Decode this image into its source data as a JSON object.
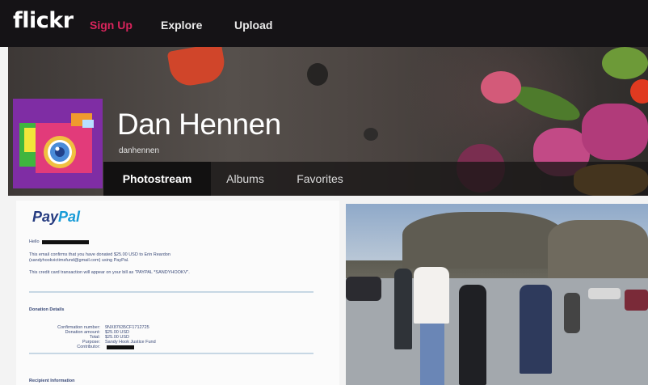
{
  "nav": {
    "logo": "flickr",
    "items": [
      {
        "label": "Sign Up",
        "color": "#d9245c"
      },
      {
        "label": "Explore",
        "color": "#e9e9e9"
      },
      {
        "label": "Upload",
        "color": "#e9e9e9"
      }
    ]
  },
  "profile": {
    "name": "Dan Hennen",
    "handle": "danhennen"
  },
  "tabs": [
    {
      "label": "Photostream",
      "active": true
    },
    {
      "label": "Albums",
      "active": false
    },
    {
      "label": "Favorites",
      "active": false
    }
  ],
  "receipt": {
    "logo_part1": "Pay",
    "logo_part2": "Pal",
    "greeting": "Hello",
    "line1": "This email confirms that you have donated $25.00 USD to Erin Reardon",
    "line2": "(sandyhookvictimsfund@gmail.com) using PayPal.",
    "line3": "This credit card transaction will appear on your bill as \"PAYPAL *SANDYHOOKV\".",
    "section_title": "Donation Details",
    "details": [
      {
        "label": "Confirmation number:",
        "value": "9NX87635CF1712725"
      },
      {
        "label": "Donation amount:",
        "value": "$25.00 USD"
      },
      {
        "label": "Total:",
        "value": "$25.00 USD"
      },
      {
        "label": "Purpose:",
        "value": "Sandy Hook Justice Fund"
      },
      {
        "label": "Contributor:",
        "value": ""
      }
    ],
    "footer_title": "Recipient Information"
  },
  "colors": {
    "topbar": "#151316",
    "accent": "#d9245c",
    "paypal_dark": "#253b80",
    "paypal_light": "#179bd7"
  }
}
